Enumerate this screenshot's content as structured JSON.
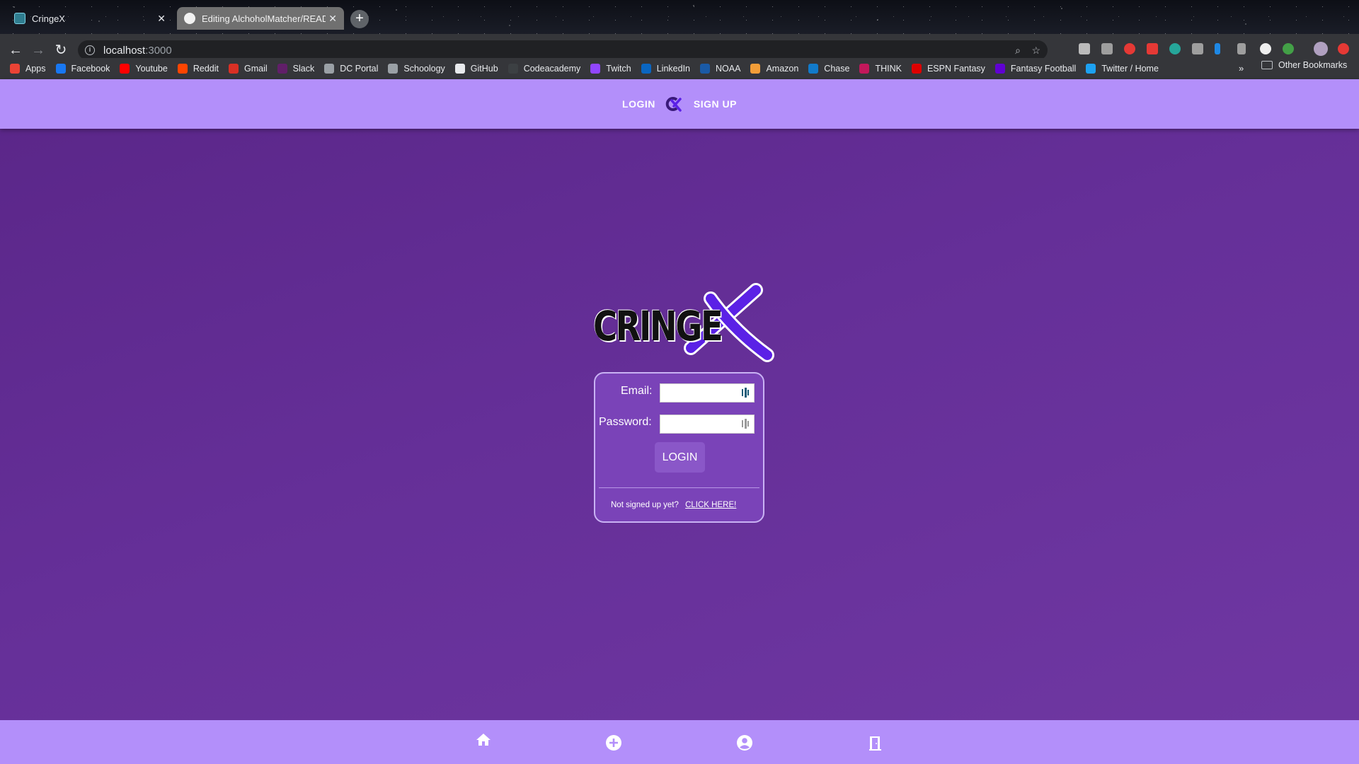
{
  "browser": {
    "tabs": [
      {
        "title": "CringeX",
        "active": true
      },
      {
        "title": "Editing AlchoholMatcher/READ",
        "active": false
      }
    ],
    "url_host": "localhost",
    "url_port": ":3000",
    "bookmarks": [
      {
        "label": "Apps",
        "icon": "apps-grid-icon",
        "color": "#ea4335"
      },
      {
        "label": "Facebook",
        "icon": "facebook-icon",
        "color": "#1877f2"
      },
      {
        "label": "Youtube",
        "icon": "youtube-icon",
        "color": "#ff0000"
      },
      {
        "label": "Reddit",
        "icon": "reddit-icon",
        "color": "#ff4500"
      },
      {
        "label": "Gmail",
        "icon": "gmail-icon",
        "color": "#d93025"
      },
      {
        "label": "Slack",
        "icon": "slack-icon",
        "color": "#611f69"
      },
      {
        "label": "DC Portal",
        "icon": "globe-icon",
        "color": "#9aa0a6"
      },
      {
        "label": "Schoology",
        "icon": "schoology-icon",
        "color": "#9aa0a6"
      },
      {
        "label": "GitHub",
        "icon": "github-icon",
        "color": "#e8eaed"
      },
      {
        "label": "Codeacademy",
        "icon": "codeacademy-icon",
        "color": "#3c4043"
      },
      {
        "label": "Twitch",
        "icon": "twitch-icon",
        "color": "#9146ff"
      },
      {
        "label": "LinkedIn",
        "icon": "linkedin-icon",
        "color": "#0a66c2"
      },
      {
        "label": "NOAA",
        "icon": "noaa-icon",
        "color": "#1a5aa6"
      },
      {
        "label": "Amazon",
        "icon": "amazon-icon",
        "color": "#f29d38"
      },
      {
        "label": "Chase",
        "icon": "chase-icon",
        "color": "#117aca"
      },
      {
        "label": "THINK",
        "icon": "think-icon",
        "color": "#c2185b"
      },
      {
        "label": "ESPN Fantasy",
        "icon": "espn-icon",
        "color": "#d00"
      },
      {
        "label": "Fantasy Football",
        "icon": "yahoo-icon",
        "color": "#6001d2"
      },
      {
        "label": "Twitter / Home",
        "icon": "twitter-icon",
        "color": "#1da1f2"
      }
    ],
    "bookmarks_more": "»",
    "other_bookmarks": "Other Bookmarks"
  },
  "app": {
    "nav_login": "LOGIN",
    "nav_signup": "SIGN UP",
    "logo_text": "CRINGE",
    "form": {
      "email_label": "Email:",
      "email_value": "",
      "password_label": "Password:",
      "password_value": "",
      "login_button": "LOGIN",
      "signup_prompt": "Not signed up yet?",
      "signup_link": "CLICK HERE!"
    },
    "bottom_nav": [
      {
        "icon": "home-icon"
      },
      {
        "icon": "add-circle-icon"
      },
      {
        "icon": "account-circle-icon"
      },
      {
        "icon": "exit-door-icon"
      }
    ]
  },
  "colors": {
    "nav_bar": "#b38ffa",
    "page_bg": "#652f98",
    "accent": "#5b21e6"
  }
}
